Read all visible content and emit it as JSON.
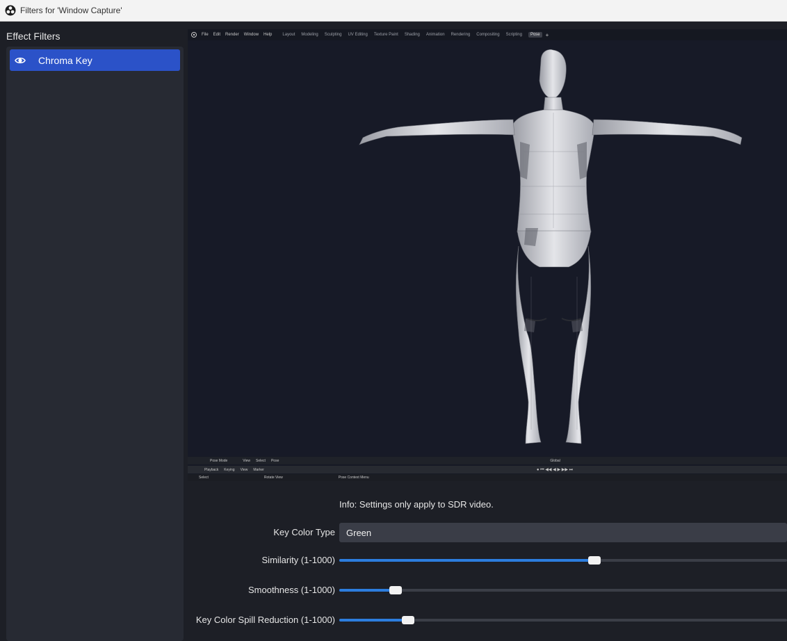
{
  "window": {
    "title": "Filters for 'Window Capture'"
  },
  "panel": {
    "heading": "Effect Filters",
    "filters": [
      {
        "label": "Chroma Key",
        "enabled": true
      }
    ]
  },
  "preview": {
    "blender": {
      "menus": [
        "File",
        "Edit",
        "Render",
        "Window",
        "Help"
      ],
      "workspaces": [
        "Layout",
        "Modeling",
        "Sculpting",
        "UV Editing",
        "Texture Paint",
        "Shading",
        "Animation",
        "Rendering",
        "Compositing",
        "Scripting",
        "Pose"
      ],
      "active_workspace_index": 10,
      "header_bar": [
        "Pose Mode",
        "View",
        "Select",
        "Pose",
        "Global"
      ],
      "timeline_bar": [
        "Playback",
        "Keying",
        "View",
        "Marker"
      ],
      "status_bar": [
        "Select",
        "Rotate View",
        "Pose Context Menu"
      ]
    }
  },
  "settings": {
    "info": "Info: Settings only apply to SDR video.",
    "key_color_type": {
      "label": "Key Color Type",
      "value": "Green"
    },
    "similarity": {
      "label": "Similarity (1-1000)",
      "fraction": 0.57
    },
    "smoothness": {
      "label": "Smoothness (1-1000)",
      "fraction": 0.125
    },
    "spill": {
      "label": "Key Color Spill Reduction (1-1000)",
      "fraction": 0.153
    }
  },
  "colors": {
    "accent": "#2c7dde",
    "selected": "#2b52c8",
    "panel_bg": "#272a33",
    "window_bg": "#1d1f26"
  },
  "icons": {
    "app": "obs-logo-icon",
    "visibility": "eye-icon"
  }
}
